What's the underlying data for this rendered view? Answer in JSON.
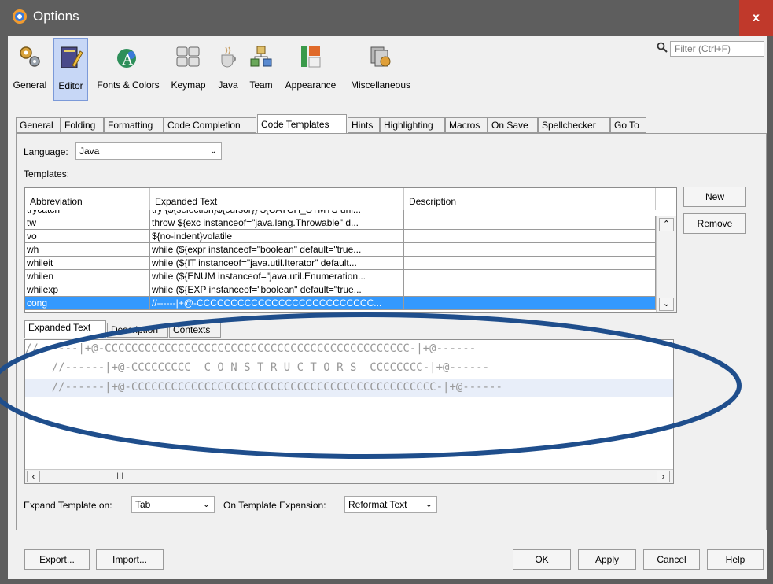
{
  "window": {
    "title": "Options",
    "close_label": "x"
  },
  "filter": {
    "placeholder": "Filter (Ctrl+F)"
  },
  "categories": [
    {
      "label": "General",
      "icon": "gears-icon"
    },
    {
      "label": "Editor",
      "icon": "editor-icon",
      "selected": true
    },
    {
      "label": "Fonts & Colors",
      "icon": "fonts-colors-icon"
    },
    {
      "label": "Keymap",
      "icon": "keymap-icon"
    },
    {
      "label": "Java",
      "icon": "java-icon"
    },
    {
      "label": "Team",
      "icon": "team-icon"
    },
    {
      "label": "Appearance",
      "icon": "appearance-icon"
    },
    {
      "label": "Miscellaneous",
      "icon": "miscellaneous-icon"
    }
  ],
  "tabs": [
    "General",
    "Folding",
    "Formatting",
    "Code Completion",
    "Code Templates",
    "Hints",
    "Highlighting",
    "Macros",
    "On Save",
    "Spellchecker",
    "Go To"
  ],
  "active_tab": "Code Templates",
  "language": {
    "label": "Language:",
    "value": "Java"
  },
  "templates_label": "Templates:",
  "table": {
    "headers": [
      "Abbreviation",
      "Expanded Text",
      "Description"
    ],
    "partial_row": {
      "abbr": "trycatch",
      "text": "try {${selection}${cursor}} ${CATCH_STMTS uni..."
    },
    "rows": [
      {
        "abbr": "tw",
        "text": "throw ${exc instanceof=\"java.lang.Throwable\" d...",
        "desc": ""
      },
      {
        "abbr": "vo",
        "text": "${no-indent}volatile",
        "desc": ""
      },
      {
        "abbr": "wh",
        "text": "while (${expr instanceof=\"boolean\" default=\"true...",
        "desc": ""
      },
      {
        "abbr": "whileit",
        "text": "while (${IT instanceof=\"java.util.Iterator\" default...",
        "desc": ""
      },
      {
        "abbr": "whilen",
        "text": "while (${ENUM instanceof=\"java.util.Enumeration...",
        "desc": ""
      },
      {
        "abbr": "whilexp",
        "text": "while (${EXP instanceof=\"boolean\" default=\"true...",
        "desc": ""
      },
      {
        "abbr": "cong",
        "text": "//------|+@-CCCCCCCCCCCCCCCCCCCCCCCCCC...",
        "desc": "",
        "selected": true
      }
    ]
  },
  "buttons": {
    "new": "New",
    "remove": "Remove"
  },
  "sub_tabs": [
    "Expanded Text",
    "Description",
    "Contexts"
  ],
  "editor": {
    "lines": [
      "//------|+@-CCCCCCCCCCCCCCCCCCCCCCCCCCCCCCCCCCCCCCCCCCCCCC-|+@------",
      "    //------|+@-CCCCCCCCC  C O N S T R U C T O R S  CCCCCCCC-|+@------",
      "    //------|+@-CCCCCCCCCCCCCCCCCCCCCCCCCCCCCCCCCCCCCCCCCCCCCC-|+@------"
    ],
    "hscroll_thumb": "III"
  },
  "expand_on": {
    "label": "Expand Template on:",
    "value": "Tab"
  },
  "on_expansion": {
    "label": "On Template Expansion:",
    "value": "Reformat Text"
  },
  "footer": {
    "export": "Export...",
    "import": "Import...",
    "ok": "OK",
    "apply": "Apply",
    "cancel": "Cancel",
    "help": "Help"
  },
  "colors": {
    "selection": "#3399ff",
    "annotation": "#1f4e8c",
    "titlebar": "#5e5e5e"
  }
}
